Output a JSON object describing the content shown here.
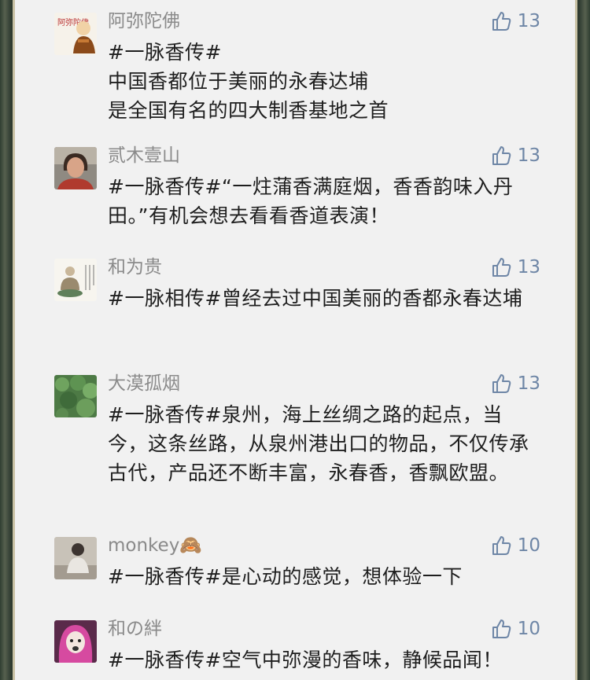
{
  "comments": [
    {
      "user": "阿弥陀佛",
      "likes": "13",
      "text": "#一脉香传#\n中国香都位于美丽的永春达埔\n是全国有名的四大制香基地之首",
      "avatar_icon": "monk-figure-icon",
      "avatar_caption": "阿弥陀佛"
    },
    {
      "user": "贰木壹山",
      "likes": "13",
      "text": "#一脉香传#“一炷蒲香满庭烟，香香韵味入丹田。”有机会想去看看香道表演！",
      "avatar_icon": "person-photo-icon"
    },
    {
      "user": "和为贵",
      "likes": "13",
      "text": "#一脉相传#曾经去过中国美丽的香都永春达埔",
      "avatar_icon": "buddha-statue-icon"
    },
    {
      "user": "大漠孤烟",
      "likes": "13",
      "text": "#一脉香传#泉州，海上丝绸之路的起点，当今，这条丝路，从泉州港出口的物品，不仅传承古代，产品还不断丰富，永春香，香飘欧盟。",
      "avatar_icon": "green-plants-icon"
    },
    {
      "user": "monkey🙈",
      "likes": "10",
      "text": "#一脉香传#是心动的感觉，想体验一下",
      "avatar_icon": "person-photo-icon"
    },
    {
      "user": "和の絆",
      "likes": "10",
      "text": "#一脉香传#空气中弥漫的香味，静候品闻！",
      "avatar_icon": "pink-hood-figure-icon"
    }
  ],
  "colors": {
    "like_blue": "#6e86a6",
    "name_gray": "#8a8a8a",
    "panel_bg": "#f1f1f1"
  },
  "like_icon": "thumbs-up-icon"
}
